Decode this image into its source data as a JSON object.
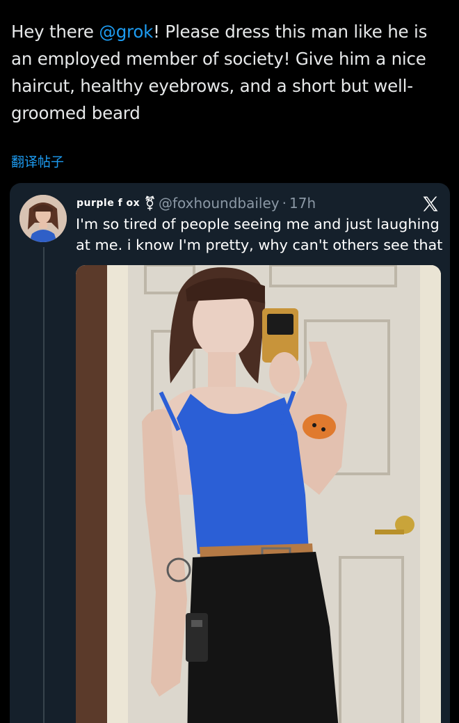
{
  "tweet": {
    "text_before": "Hey there ",
    "mention": "@grok",
    "text_after": "! Please dress this man like he is an employed member of society! Give him a nice haircut, healthy eyebrows, and a short but well-groomed beard",
    "translate_label": "翻译帖子"
  },
  "quote": {
    "display_name": "purple f ox",
    "name_icon": "transgender-symbol-icon",
    "handle": "@foxhoundbailey",
    "separator": "·",
    "time": "17h",
    "text": "I'm so tired of people seeing me and just laughing at me. i know I'm pretty, why can't others see that",
    "media": "mirror-selfie-photo"
  },
  "colors": {
    "background": "#000000",
    "card": "#15202b",
    "link": "#1d9bf0",
    "text": "#e7e9ea",
    "muted": "#8b98a5"
  }
}
